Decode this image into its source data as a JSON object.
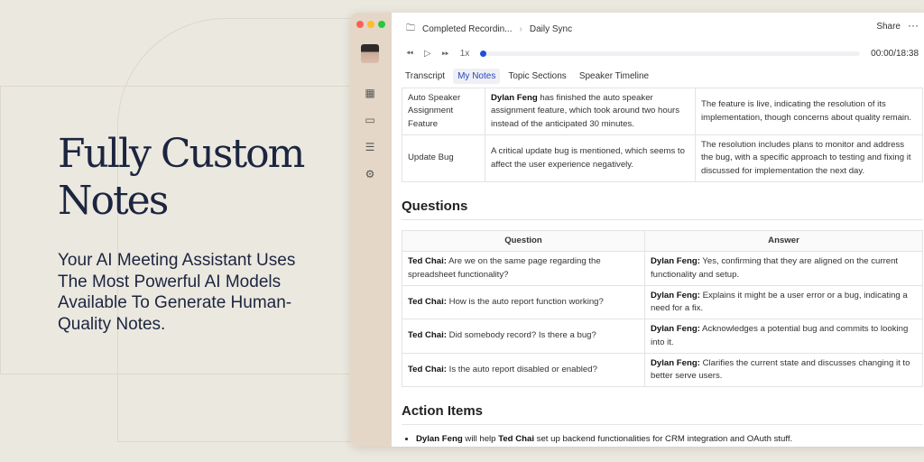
{
  "hero": {
    "title": "Fully Custom Notes",
    "subtitle": "Your AI Meeting Assistant Uses The Most Powerful AI Models Available To Generate Human-Quality Notes."
  },
  "breadcrumb": {
    "parent": "Completed Recordin...",
    "current": "Daily Sync"
  },
  "header": {
    "share": "Share",
    "more": "···"
  },
  "player": {
    "speed": "1x",
    "time": "00:00/18:38",
    "progress": 0
  },
  "tabs": [
    {
      "label": "Transcript"
    },
    {
      "label": "My Notes"
    },
    {
      "label": "Topic Sections"
    },
    {
      "label": "Speaker Timeline"
    }
  ],
  "topics": [
    {
      "topic": "Auto Speaker Assignment Feature",
      "speaker": "Dylan Feng",
      "detail": " has finished the auto speaker assignment feature, which took around two hours instead of the anticipated 30 minutes.",
      "resolution": "The feature is live, indicating the resolution of its implementation, though concerns about quality remain."
    },
    {
      "topic": "Update Bug",
      "speaker": "",
      "detail": "A critical update bug is mentioned, which seems to affect the user experience negatively.",
      "resolution": "The resolution includes plans to monitor and address the bug, with a specific approach to testing and fixing it discussed for implementation the next day."
    }
  ],
  "questions": {
    "heading": "Questions",
    "col_question": "Question",
    "col_answer": "Answer",
    "rows": [
      {
        "q_speaker": "Ted Chai:",
        "q": " Are we on the same page regarding the spreadsheet functionality?",
        "a_speaker": "Dylan Feng:",
        "a": " Yes, confirming that they are aligned on the current functionality and setup."
      },
      {
        "q_speaker": "Ted Chai:",
        "q": " How is the auto report function working?",
        "a_speaker": "Dylan Feng:",
        "a": " Explains it might be a user error or a bug, indicating a need for a fix."
      },
      {
        "q_speaker": "Ted Chai:",
        "q": " Did somebody record? Is there a bug?",
        "a_speaker": "Dylan Feng:",
        "a": " Acknowledges a potential bug and commits to looking into it."
      },
      {
        "q_speaker": "Ted Chai:",
        "q": " Is the auto report disabled or enabled?",
        "a_speaker": "Dylan Feng:",
        "a": " Clarifies the current state and discusses changing it to better serve users."
      }
    ]
  },
  "actions": {
    "heading": "Action Items",
    "items": [
      {
        "who": "Dylan Feng",
        "mid": " will help ",
        "whom": "Ted Chai",
        "rest": " set up backend functionalities for CRM integration and OAuth stuff."
      }
    ]
  }
}
